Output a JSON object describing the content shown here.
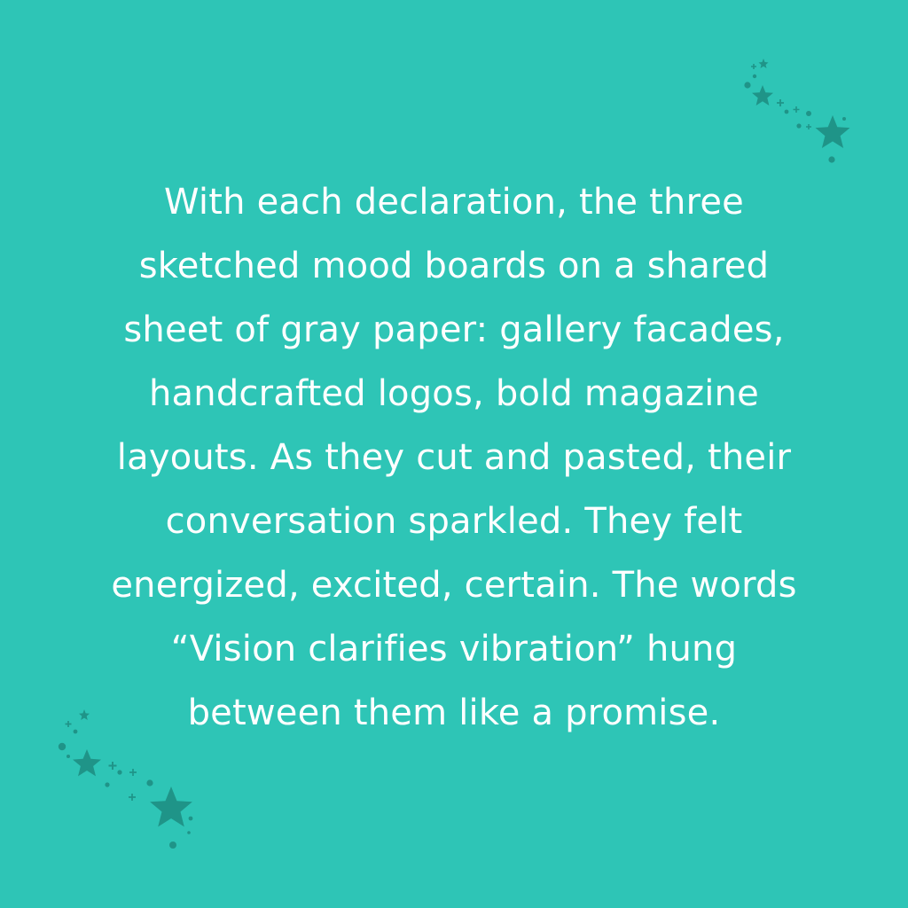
{
  "background_color": "#2ec5b6",
  "text_color": "#ffffff",
  "decor_color": "#1f9488",
  "decorations": {
    "top_right_icon": "star-sparkles-icon",
    "bottom_left_icon": "star-sparkles-icon"
  },
  "text": {
    "lines": [
      "With each declaration, the three",
      "sketched mood boards on a shared",
      "sheet of gray paper: gallery facades,",
      "handcrafted logos, bold magazine",
      "layouts. As they cut and pasted, their",
      "conversation sparkled. They felt",
      "energized, excited, certain. The words",
      "“Vision clarifies vibration” hung",
      "between them like a promise."
    ]
  }
}
